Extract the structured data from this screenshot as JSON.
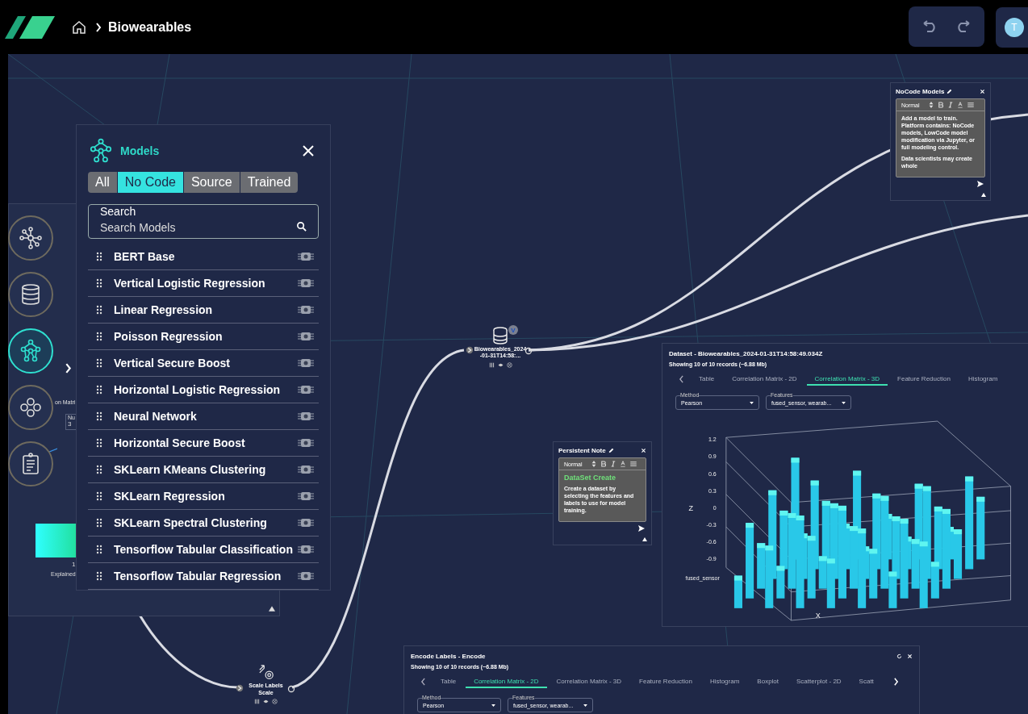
{
  "header": {
    "breadcrumb": "Biowearables",
    "avatar": "T"
  },
  "sidebar": {
    "items": [
      {
        "kind": "graph",
        "selected": false
      },
      {
        "kind": "database",
        "selected": false
      },
      {
        "kind": "model",
        "selected": true
      },
      {
        "kind": "cluster",
        "selected": false
      },
      {
        "kind": "notes",
        "selected": false
      }
    ]
  },
  "background_panel": {
    "tab_fragment": "on Matri",
    "field_label": "Nu",
    "field_value": "3",
    "axis_tick": "1",
    "axis_label": "Explained"
  },
  "models_panel": {
    "title": "Models",
    "tabs": [
      {
        "label": "All",
        "selected": false
      },
      {
        "label": "No Code",
        "selected": true
      },
      {
        "label": "Source",
        "selected": false
      },
      {
        "label": "Trained",
        "selected": false
      }
    ],
    "search": {
      "label": "Search",
      "placeholder": "Search Models"
    },
    "items": [
      {
        "name": "BERT Base"
      },
      {
        "name": "Vertical Logistic Regression"
      },
      {
        "name": "Linear Regression"
      },
      {
        "name": "Poisson Regression"
      },
      {
        "name": "Vertical Secure Boost"
      },
      {
        "name": "Horizontal Logistic Regression"
      },
      {
        "name": "Neural Network"
      },
      {
        "name": "Horizontal Secure Boost"
      },
      {
        "name": "SKLearn KMeans Clustering"
      },
      {
        "name": "SKLearn Regression"
      },
      {
        "name": "SKLearn Spectral Clustering"
      },
      {
        "name": "Tensorflow Tabular Classification"
      },
      {
        "name": "Tensorflow Tabular Regression"
      }
    ]
  },
  "nodes": [
    {
      "kind": "dataset",
      "label": "Biowearables_2024-01-31T14:58:...",
      "badge": "V"
    },
    {
      "kind": "scale",
      "label": "Scale Labels",
      "sublabel": "Scale"
    }
  ],
  "notes": [
    {
      "title": "NoCode Models",
      "format": "Normal",
      "body": [
        "Add a model to train. Platform contains: NoCode models, LowCode model modification via Jupyter, or full modeling control.",
        "Data scientists may create whole"
      ]
    },
    {
      "title": "Persistent Note",
      "format": "Normal",
      "heading": "DataSet Create",
      "body": [
        "Create a dataset by selecting the features and labels to use for model training."
      ]
    }
  ],
  "dataset_panel": {
    "title": "Dataset - Biowearables_2024-01-31T14:58:49.034Z",
    "subtitle": "Showing 10 of 10 records (~6.88 Mb)",
    "tabs": [
      {
        "label": "Table",
        "selected": false
      },
      {
        "label": "Correlation Matrix - 2D",
        "selected": false
      },
      {
        "label": "Correlation Matrix - 3D",
        "selected": true
      },
      {
        "label": "Feature Reduction",
        "selected": false
      },
      {
        "label": "Histogram",
        "selected": false
      }
    ],
    "method": {
      "label": "Method",
      "value": "Pearson"
    },
    "features": {
      "label": "Features",
      "value": "fused_sensor, wearab..."
    },
    "chart": {
      "z_label": "Z",
      "z_ticks": [
        "1.2",
        "0.9",
        "0.6",
        "0.3",
        "0",
        "-0.3",
        "-0.6",
        "-0.9"
      ],
      "x_label": "X",
      "row_label": "fused_sensor"
    }
  },
  "encode_panel": {
    "title": "Encode Labels - Encode",
    "subtitle": "Showing 10 of 10 records (~6.88 Mb)",
    "tabs": [
      {
        "label": "Table",
        "selected": false
      },
      {
        "label": "Correlation Matrix - 2D",
        "selected": true
      },
      {
        "label": "Correlation Matrix - 3D",
        "selected": false
      },
      {
        "label": "Feature Reduction",
        "selected": false
      },
      {
        "label": "Histogram",
        "selected": false
      },
      {
        "label": "Boxplot",
        "selected": false
      },
      {
        "label": "Scatterplot - 2D",
        "selected": false
      },
      {
        "label": "Scatt",
        "selected": false
      }
    ],
    "method": {
      "label": "Method",
      "value": "Pearson"
    },
    "features": {
      "label": "Features",
      "value": "fused_sensor, wearab..."
    }
  }
}
